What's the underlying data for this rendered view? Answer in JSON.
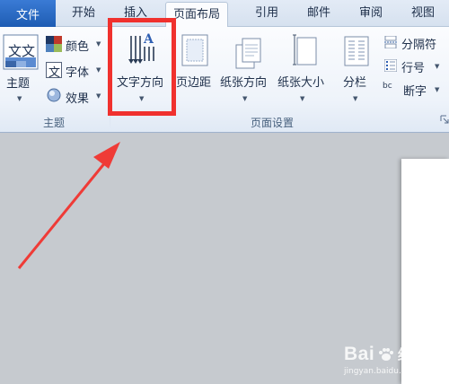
{
  "tabs": {
    "file": "文件",
    "items": [
      {
        "label": "开始"
      },
      {
        "label": "插入"
      },
      {
        "label": "页面布局"
      },
      {
        "label": "引用"
      },
      {
        "label": "邮件"
      },
      {
        "label": "审阅"
      },
      {
        "label": "视图"
      }
    ]
  },
  "theme_group": {
    "label": "主题",
    "themes": "主题",
    "colors": "颜色",
    "fonts": "字体",
    "effects": "效果",
    "icon_text": "文文"
  },
  "page_setup_group": {
    "label": "页面设置",
    "text_direction": "文字方向",
    "margins": "页边距",
    "orientation": "纸张方向",
    "size": "纸张大小",
    "columns": "分栏",
    "breaks": "分隔符",
    "line_numbers": "行号",
    "hyphenation": "断字",
    "hyphen_icon_text": "bc",
    "text_dir_icon_letter": "A"
  },
  "watermark": {
    "brand": "Bai",
    "brand_cn": "经验",
    "url": "jingyan.baidu.com"
  },
  "colors": {
    "highlight": "#f0312e",
    "arrow": "#ef3b37",
    "file_tab": "#2a6bc7"
  }
}
